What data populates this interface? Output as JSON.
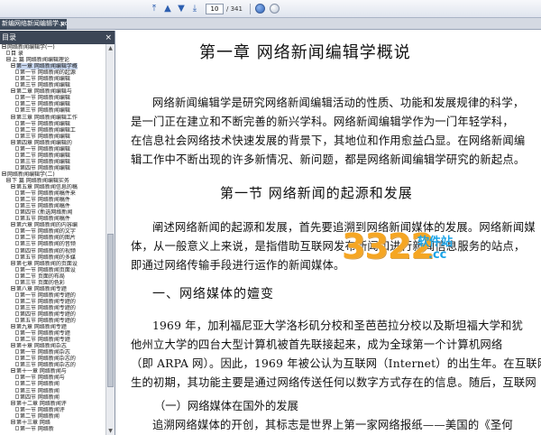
{
  "toolbar": {
    "page_current": "10",
    "page_total": "/ 341"
  },
  "tab": {
    "title": "新编网络新闻编辑学.pdf",
    "close_glyph": "×"
  },
  "sidebar": {
    "header": "目录",
    "close_glyph": "×",
    "tree": [
      {
        "indent": 0,
        "icon": "box",
        "label": "网络新闻编辑学(一)"
      },
      {
        "indent": 1,
        "icon": "doc",
        "label": "目  录"
      },
      {
        "indent": 1,
        "icon": "box",
        "label": "上  篇    网络新闻编辑理论"
      },
      {
        "indent": 2,
        "icon": "box",
        "label": "第一章    网络新闻编辑学概",
        "selected": true
      },
      {
        "indent": 3,
        "icon": "doc",
        "label": "第一节    网络新闻的起源"
      },
      {
        "indent": 3,
        "icon": "doc",
        "label": "第二节    网络新闻编辑"
      },
      {
        "indent": 3,
        "icon": "doc",
        "label": "第三节    网络新闻编辑"
      },
      {
        "indent": 2,
        "icon": "box",
        "label": "第二章    网络新闻编辑与"
      },
      {
        "indent": 3,
        "icon": "doc",
        "label": "第一节    网络新闻编辑"
      },
      {
        "indent": 3,
        "icon": "doc",
        "label": "第二节    网络新闻编辑"
      },
      {
        "indent": 3,
        "icon": "doc",
        "label": "第三节    网络新闻编辑"
      },
      {
        "indent": 2,
        "icon": "box",
        "label": "第三章    网络新闻编辑工作"
      },
      {
        "indent": 3,
        "icon": "doc",
        "label": "第一节    网络新闻编辑"
      },
      {
        "indent": 3,
        "icon": "doc",
        "label": "第二节    网络新闻编辑工"
      },
      {
        "indent": 3,
        "icon": "doc",
        "label": "第三节    网络新闻编辑"
      },
      {
        "indent": 2,
        "icon": "box",
        "label": "第四章    网络新闻编辑的"
      },
      {
        "indent": 3,
        "icon": "doc",
        "label": "第一节    网络新闻编辑"
      },
      {
        "indent": 3,
        "icon": "doc",
        "label": "第二节    网络新闻编辑"
      },
      {
        "indent": 3,
        "icon": "doc",
        "label": "第三节    网络新闻编辑"
      },
      {
        "indent": 3,
        "icon": "doc",
        "label": "第四节    网络新闻编辑"
      },
      {
        "indent": 0,
        "icon": "box",
        "label": "网络新闻编辑学(二)"
      },
      {
        "indent": 1,
        "icon": "box",
        "label": "下  篇    网络新闻编辑实务"
      },
      {
        "indent": 2,
        "icon": "box",
        "label": "第五章    网络新闻信息的稿"
      },
      {
        "indent": 3,
        "icon": "doc",
        "label": "第一节    网络新闻稿件来"
      },
      {
        "indent": 3,
        "icon": "doc",
        "label": "第二节    网络新闻稿件"
      },
      {
        "indent": 3,
        "icon": "doc",
        "label": "第三节    网络新闻稿件"
      },
      {
        "indent": 3,
        "icon": "doc",
        "label": "第四节    (新选网络新闻"
      },
      {
        "indent": 3,
        "icon": "doc",
        "label": "第五节    网络新闻稿件"
      },
      {
        "indent": 2,
        "icon": "box",
        "label": "第六章    网络新闻的内容编"
      },
      {
        "indent": 3,
        "icon": "doc",
        "label": "第一节    网络新闻的文字"
      },
      {
        "indent": 3,
        "icon": "doc",
        "label": "第二节    网络新闻的图片"
      },
      {
        "indent": 3,
        "icon": "doc",
        "label": "第三节    网络新闻的音频"
      },
      {
        "indent": 3,
        "icon": "doc",
        "label": "第四节    网络新闻的视频"
      },
      {
        "indent": 3,
        "icon": "doc",
        "label": "第五节    网络新闻的多媒"
      },
      {
        "indent": 2,
        "icon": "box",
        "label": "第七章    网络新闻的页面设"
      },
      {
        "indent": 3,
        "icon": "doc",
        "label": "第一节    网络新闻页面设"
      },
      {
        "indent": 3,
        "icon": "doc",
        "label": "第二节    页面的布局"
      },
      {
        "indent": 3,
        "icon": "doc",
        "label": "第三节    页面的色彩"
      },
      {
        "indent": 2,
        "icon": "box",
        "label": "第八章    网络新闻专题"
      },
      {
        "indent": 3,
        "icon": "doc",
        "label": "第一节    网络新闻专题的"
      },
      {
        "indent": 3,
        "icon": "doc",
        "label": "第二节    网络新闻专题的"
      },
      {
        "indent": 3,
        "icon": "doc",
        "label": "第三节    网络新闻专题的"
      },
      {
        "indent": 3,
        "icon": "doc",
        "label": "第四节    网络新闻专题的"
      },
      {
        "indent": 3,
        "icon": "doc",
        "label": "第五节    网络新闻专题的"
      },
      {
        "indent": 2,
        "icon": "box",
        "label": "第九章    网络新闻专题"
      },
      {
        "indent": 3,
        "icon": "doc",
        "label": "第一节    网络新闻专题"
      },
      {
        "indent": 3,
        "icon": "doc",
        "label": "第二节    网络新闻专题"
      },
      {
        "indent": 2,
        "icon": "box",
        "label": "第十章    网络新闻杂志"
      },
      {
        "indent": 3,
        "icon": "doc",
        "label": "第一节    网络新闻杂志"
      },
      {
        "indent": 3,
        "icon": "doc",
        "label": "第二节    网络新闻杂志的"
      },
      {
        "indent": 3,
        "icon": "doc",
        "label": "第三节    网络新闻杂志的"
      },
      {
        "indent": 2,
        "icon": "box",
        "label": "第十一章    网络新闻与"
      },
      {
        "indent": 3,
        "icon": "doc",
        "label": "第一节    网络新闻与"
      },
      {
        "indent": 3,
        "icon": "doc",
        "label": "第二节    网络新闻"
      },
      {
        "indent": 3,
        "icon": "doc",
        "label": "第三节    网络新闻"
      },
      {
        "indent": 3,
        "icon": "doc",
        "label": "第四节    网络新闻"
      },
      {
        "indent": 2,
        "icon": "box",
        "label": "第十二章    网络新闻评"
      },
      {
        "indent": 3,
        "icon": "doc",
        "label": "第一节    网络新闻评"
      },
      {
        "indent": 3,
        "icon": "doc",
        "label": "第二节    网络新闻"
      },
      {
        "indent": 2,
        "icon": "box",
        "label": "第十三章    网络"
      },
      {
        "indent": 3,
        "icon": "doc",
        "label": "第一节    网络新"
      }
    ]
  },
  "document": {
    "chapter_title": "第一章    网络新闻编辑学概说",
    "para1": [
      "网络新闻编辑学是研究网络新闻编辑活动的性质、功能和发展规律的科学，",
      "是一门正在建立和不断完善的新兴学科。网络新闻编辑学作为一门年轻学科，",
      "在信息社会网络技术快速发展的背景下，其地位和作用愈益凸显。在网络新闻编",
      "辑工作中不断出现的许多新情况、新问题，都是网络新闻编辑学研究的新起点。"
    ],
    "section_title": "第一节    网络新闻的起源和发展",
    "para2": [
      "阐述网络新闻的起源和发展，首先要追溯到网络新闻媒体的发展。网络新闻媒",
      "体，从一般意义上来说，是指借助互联网发布新闻和进行新闻信息服务的站点，",
      "即通过网络传输手段进行运作的新闻媒体。"
    ],
    "sub_title": "一、网络媒体的嬗变",
    "para3": [
      "1969 年，加利福尼亚大学洛杉矶分校和圣芭芭拉分校以及斯坦福大学和犹",
      "他州立大学的四台大型计算机被首先联接起来，成为全球第一个计算机网络",
      "（即 ARPA 网）。因此，1969 年被公认为互联网（Internet）的出生年。在互联网诞",
      "生的初期，其功能主要是通过网络传送任何以数字方式存在的信息。随后，互联网",
      "更多地承担了作为新闻信息发布的传输手段，从而使网络媒体获得了巨大的发展。"
    ],
    "subsub_title": "（一）网络媒体在国外的发展",
    "para4": [
      "追溯网络媒体的开创，其标志是世界上第一家网络报纸——美国的《圣何"
    ]
  },
  "watermark": {
    "main": "3322",
    "soft": "软件站",
    "domain": ".cc"
  }
}
